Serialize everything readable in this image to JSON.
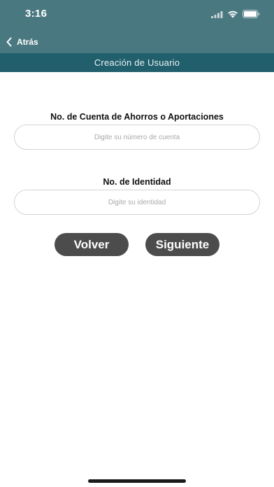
{
  "status_bar": {
    "time": "3:16",
    "icons": [
      "cellular-signal-icon",
      "wifi-icon",
      "battery-icon"
    ]
  },
  "nav": {
    "back_label": "Atrás",
    "back_icon": "chevron-left-icon"
  },
  "header": {
    "title": "Creación de Usuario"
  },
  "form": {
    "account_label": "No. de Cuenta  de Ahorros o Aportaciones",
    "account_placeholder": "Digite su número de cuenta",
    "identity_label": "No. de Identidad",
    "identity_placeholder": "Digite su identidad"
  },
  "actions": {
    "back_label": "Volver",
    "next_label": "Siguiente"
  },
  "colors": {
    "top_bar": "#4a7880",
    "subheader": "#215f6c",
    "button": "#4c4c4c",
    "input_border": "#d3d3d3"
  }
}
